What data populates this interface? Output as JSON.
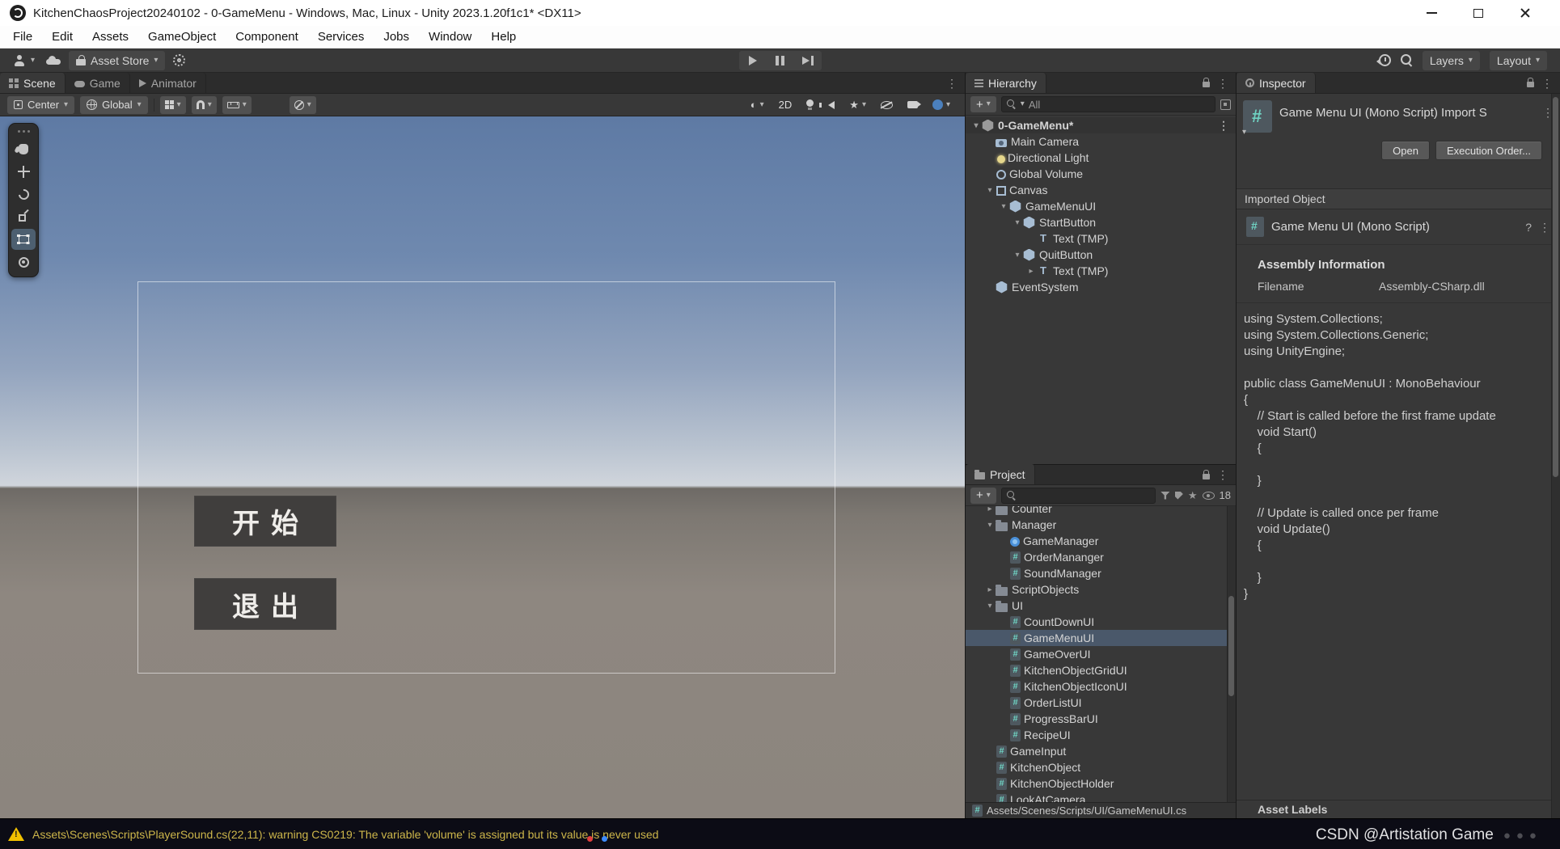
{
  "titlebar": {
    "title": "KitchenChaosProject20240102 - 0-GameMenu - Windows, Mac, Linux - Unity 2023.1.20f1c1* <DX11>"
  },
  "menubar": {
    "items": [
      "File",
      "Edit",
      "Assets",
      "GameObject",
      "Component",
      "Services",
      "Jobs",
      "Window",
      "Help"
    ]
  },
  "toolbar": {
    "asset_store_label": "Asset Store",
    "layers_label": "Layers",
    "layout_label": "Layout"
  },
  "scene_panel": {
    "tabs": [
      {
        "label": "Scene",
        "icon": "scene",
        "active": true
      },
      {
        "label": "Game",
        "icon": "game"
      },
      {
        "label": "Animator",
        "icon": "animator"
      }
    ],
    "toolbar": {
      "center_label": "Center",
      "global_label": "Global",
      "mode_2d": "2D"
    },
    "ui_buttons": [
      {
        "label": "开始"
      },
      {
        "label": "退出"
      }
    ]
  },
  "hierarchy": {
    "tab_label": "Hierarchy",
    "search_filter": "All",
    "items": [
      {
        "label": "0-GameMenu*",
        "indent": 0,
        "arrow": "down",
        "icon": "unity",
        "bold": true,
        "menu": true,
        "header": true
      },
      {
        "label": "Main Camera",
        "indent": 1,
        "icon": "camera"
      },
      {
        "label": "Directional Light",
        "indent": 1,
        "icon": "light"
      },
      {
        "label": "Global Volume",
        "indent": 1,
        "icon": "volume"
      },
      {
        "label": "Canvas",
        "indent": 1,
        "arrow": "down",
        "icon": "canvas"
      },
      {
        "label": "GameMenuUI",
        "indent": 2,
        "arrow": "down",
        "icon": "cube"
      },
      {
        "label": "StartButton",
        "indent": 3,
        "arrow": "down",
        "icon": "cube"
      },
      {
        "label": "Text (TMP)",
        "indent": 4,
        "icon": "text"
      },
      {
        "label": "QuitButton",
        "indent": 3,
        "arrow": "down",
        "icon": "cube"
      },
      {
        "label": "Text (TMP)",
        "indent": 4,
        "arrow": "right",
        "icon": "text"
      },
      {
        "label": "EventSystem",
        "indent": 1,
        "icon": "cube"
      }
    ]
  },
  "project": {
    "tab_label": "Project",
    "hidden_count": "18",
    "path": "Assets/Scenes/Scripts/UI/GameMenuUI.cs",
    "items": [
      {
        "label": "Counter",
        "indent": 1,
        "arrow": "right",
        "icon": "folder",
        "cut": true
      },
      {
        "label": "Manager",
        "indent": 1,
        "arrow": "down",
        "icon": "folder"
      },
      {
        "label": "GameManager",
        "indent": 2,
        "icon": "so"
      },
      {
        "label": "OrderMananger",
        "indent": 2,
        "icon": "cs"
      },
      {
        "label": "SoundManager",
        "indent": 2,
        "icon": "cs"
      },
      {
        "label": "ScriptObjects",
        "indent": 1,
        "arrow": "right",
        "icon": "folder"
      },
      {
        "label": "UI",
        "indent": 1,
        "arrow": "down",
        "icon": "folder"
      },
      {
        "label": "CountDownUI",
        "indent": 2,
        "icon": "cs"
      },
      {
        "label": "GameMenuUI",
        "indent": 2,
        "icon": "cs",
        "selected": true
      },
      {
        "label": "GameOverUI",
        "indent": 2,
        "icon": "cs"
      },
      {
        "label": "KitchenObjectGridUI",
        "indent": 2,
        "icon": "cs"
      },
      {
        "label": "KitchenObjectIconUI",
        "indent": 2,
        "icon": "cs"
      },
      {
        "label": "OrderListUI",
        "indent": 2,
        "icon": "cs"
      },
      {
        "label": "ProgressBarUI",
        "indent": 2,
        "icon": "cs"
      },
      {
        "label": "RecipeUI",
        "indent": 2,
        "icon": "cs"
      },
      {
        "label": "GameInput",
        "indent": 1,
        "icon": "cs"
      },
      {
        "label": "KitchenObject",
        "indent": 1,
        "icon": "cs"
      },
      {
        "label": "KitchenObjectHolder",
        "indent": 1,
        "icon": "cs"
      },
      {
        "label": "LookAtCamera",
        "indent": 1,
        "icon": "cs"
      }
    ]
  },
  "inspector": {
    "tab_label": "Inspector",
    "header_title": "Game Menu UI (Mono Script) Import S",
    "open_button": "Open",
    "execution_order_button": "Execution Order...",
    "imported_object_label": "Imported Object",
    "object_title": "Game Menu UI (Mono Script)",
    "assembly_info_label": "Assembly Information",
    "filename_label": "Filename",
    "filename_value": "Assembly-CSharp.dll",
    "code_lines": [
      "using System.Collections;",
      "using System.Collections.Generic;",
      "using UnityEngine;",
      "",
      "public class GameMenuUI : MonoBehaviour",
      "{",
      "    // Start is called before the first frame update",
      "    void Start()",
      "    {",
      "",
      "    }",
      "",
      "    // Update is called once per frame",
      "    void Update()",
      "    {",
      "",
      "    }",
      "}"
    ],
    "asset_labels_label": "Asset Labels"
  },
  "statusbar": {
    "warning_text": "Assets\\Scenes\\Scripts\\PlayerSound.cs(22,11): warning CS0219: The variable 'volume' is assigned but its value is never used",
    "watermark": "CSDN @Artistation Game"
  },
  "icons": {
    "more": "⋮",
    "caret": "▾",
    "star": "★",
    "shaded_sphere": "◐",
    "help": "?",
    "plus": "+"
  }
}
